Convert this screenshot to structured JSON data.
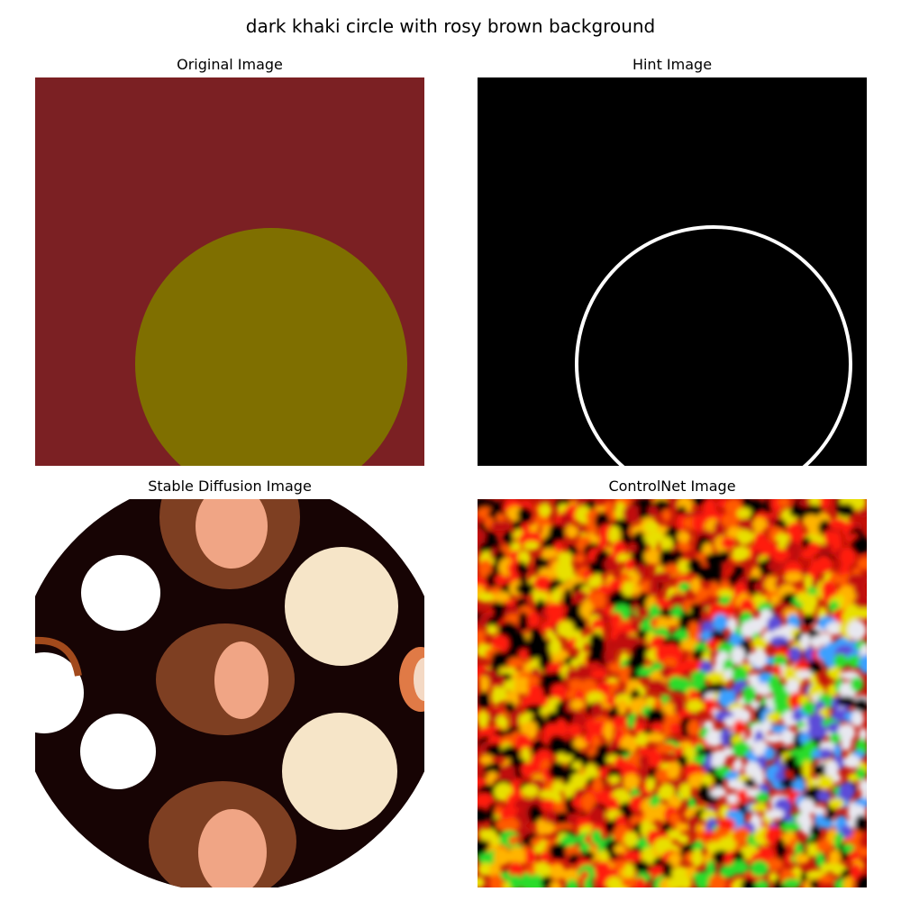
{
  "figure": {
    "title": "dark khaki circle with rosy brown background"
  },
  "panels": [
    {
      "title": "Original Image"
    },
    {
      "title": "Hint Image"
    },
    {
      "title": "Stable Diffusion Image"
    },
    {
      "title": "ControlNet Image"
    }
  ],
  "colors": {
    "original_background": "#7b2023",
    "original_circle": "#7f6f00",
    "hint_background": "#000000",
    "hint_edge": "#ffffff",
    "sd_background": "#ffffff",
    "sd_disc": "#170404",
    "sd_ring": "#7e3f22",
    "sd_core": "#f0a585",
    "sd_cream": "#f6e5c8",
    "sd_white": "#ffffff"
  },
  "controlnet_palette": [
    "#ff1a0a",
    "#ff5a00",
    "#ffb400",
    "#e8e000",
    "#2bdc2b",
    "#3aa0ff",
    "#5b4bd8",
    "#e8e8f0",
    "#c01010",
    "#000000"
  ]
}
